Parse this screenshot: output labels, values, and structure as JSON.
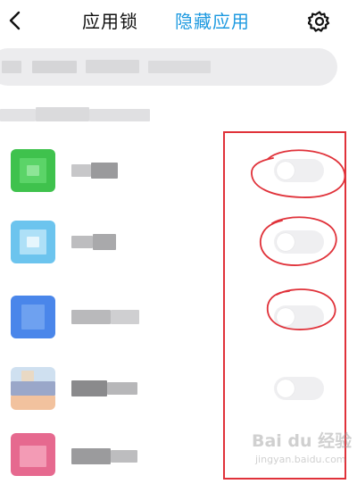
{
  "header": {
    "tab_app_lock": "应用锁",
    "tab_hidden_apps": "隐藏应用",
    "active_tab_color": "#1e9ae0"
  },
  "icons": {
    "back": "chevron-left-icon",
    "settings": "gear-icon"
  },
  "apps": [
    {
      "toggle_on": false
    },
    {
      "toggle_on": false
    },
    {
      "toggle_on": false
    },
    {
      "toggle_on": false
    },
    {
      "toggle_on": false
    }
  ],
  "annotation_color": "#e0323a",
  "watermark": {
    "logo": "Bai du 经验",
    "subtitle": "jingyan.baidu.com"
  }
}
